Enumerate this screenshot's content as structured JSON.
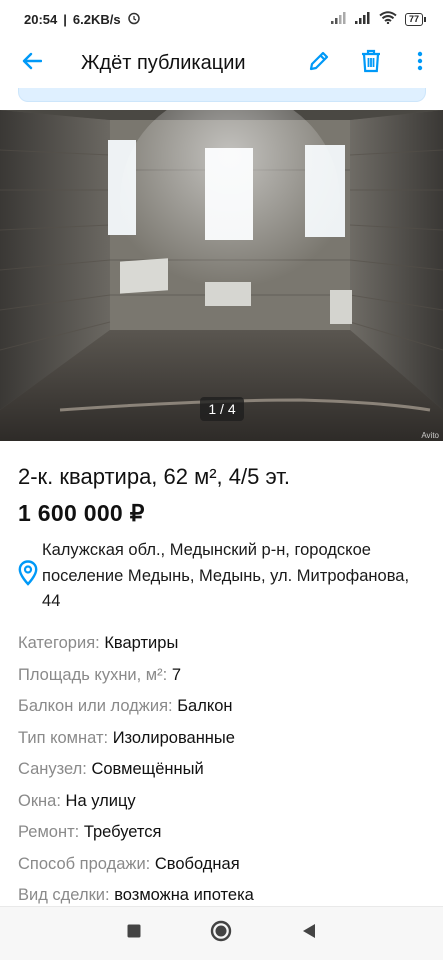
{
  "status_bar": {
    "time": "20:54",
    "network_speed": "6.2KB/s",
    "battery": "77"
  },
  "app_bar": {
    "title": "Ждёт публикации"
  },
  "gallery": {
    "counter": "1 / 4",
    "watermark": "Avito"
  },
  "listing": {
    "headline": "2-к. квартира, 62 м², 4/5 эт.",
    "price": "1 600 000 ₽",
    "address": "Калужская обл., Медынский р-н, городское поселение Медынь, Медынь, ул. Митрофанова, 44",
    "properties": [
      {
        "key": "Категория:",
        "value": "Квартиры"
      },
      {
        "key": "Площадь кухни, м²:",
        "value": "7"
      },
      {
        "key": "Балкон или лоджия:",
        "value": "Балкон"
      },
      {
        "key": "Тип комнат:",
        "value": "Изолированные"
      },
      {
        "key": "Санузел:",
        "value": "Совмещённый"
      },
      {
        "key": "Окна:",
        "value": "На улицу"
      },
      {
        "key": "Ремонт:",
        "value": "Требуется"
      },
      {
        "key": "Способ продажи:",
        "value": "Свободная"
      },
      {
        "key": "Вид сделки:",
        "value": "возможна ипотека"
      }
    ]
  },
  "colors": {
    "accent": "#0099f7",
    "banner": "#dff0ff",
    "label_gray": "#8a8a8a"
  },
  "icons": {
    "back": "arrow-left-icon",
    "edit": "pencil-icon",
    "delete": "trash-icon",
    "more": "more-vertical-icon",
    "location": "map-pin-icon"
  }
}
